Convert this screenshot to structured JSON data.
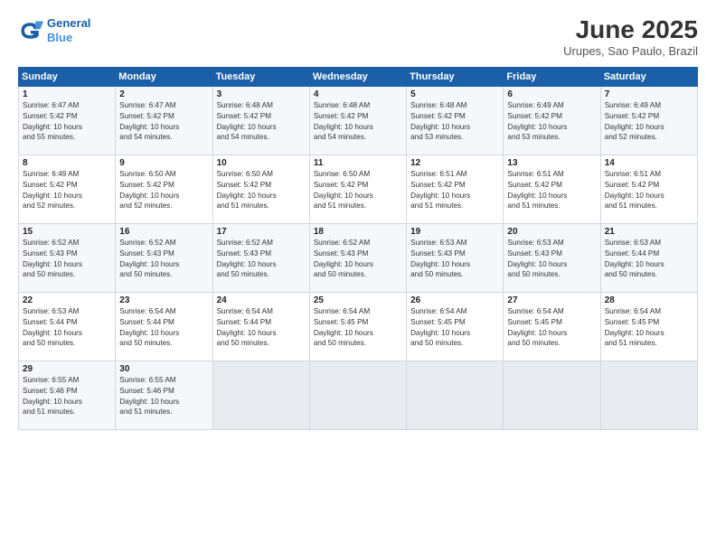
{
  "logo": {
    "line1": "General",
    "line2": "Blue"
  },
  "title": "June 2025",
  "subtitle": "Urupes, Sao Paulo, Brazil",
  "days_of_week": [
    "Sunday",
    "Monday",
    "Tuesday",
    "Wednesday",
    "Thursday",
    "Friday",
    "Saturday"
  ],
  "weeks": [
    [
      {
        "day": "1",
        "info": "Sunrise: 6:47 AM\nSunset: 5:42 PM\nDaylight: 10 hours\nand 55 minutes."
      },
      {
        "day": "2",
        "info": "Sunrise: 6:47 AM\nSunset: 5:42 PM\nDaylight: 10 hours\nand 54 minutes."
      },
      {
        "day": "3",
        "info": "Sunrise: 6:48 AM\nSunset: 5:42 PM\nDaylight: 10 hours\nand 54 minutes."
      },
      {
        "day": "4",
        "info": "Sunrise: 6:48 AM\nSunset: 5:42 PM\nDaylight: 10 hours\nand 54 minutes."
      },
      {
        "day": "5",
        "info": "Sunrise: 6:48 AM\nSunset: 5:42 PM\nDaylight: 10 hours\nand 53 minutes."
      },
      {
        "day": "6",
        "info": "Sunrise: 6:49 AM\nSunset: 5:42 PM\nDaylight: 10 hours\nand 53 minutes."
      },
      {
        "day": "7",
        "info": "Sunrise: 6:49 AM\nSunset: 5:42 PM\nDaylight: 10 hours\nand 52 minutes."
      }
    ],
    [
      {
        "day": "8",
        "info": "Sunrise: 6:49 AM\nSunset: 5:42 PM\nDaylight: 10 hours\nand 52 minutes."
      },
      {
        "day": "9",
        "info": "Sunrise: 6:50 AM\nSunset: 5:42 PM\nDaylight: 10 hours\nand 52 minutes."
      },
      {
        "day": "10",
        "info": "Sunrise: 6:50 AM\nSunset: 5:42 PM\nDaylight: 10 hours\nand 51 minutes."
      },
      {
        "day": "11",
        "info": "Sunrise: 6:50 AM\nSunset: 5:42 PM\nDaylight: 10 hours\nand 51 minutes."
      },
      {
        "day": "12",
        "info": "Sunrise: 6:51 AM\nSunset: 5:42 PM\nDaylight: 10 hours\nand 51 minutes."
      },
      {
        "day": "13",
        "info": "Sunrise: 6:51 AM\nSunset: 5:42 PM\nDaylight: 10 hours\nand 51 minutes."
      },
      {
        "day": "14",
        "info": "Sunrise: 6:51 AM\nSunset: 5:42 PM\nDaylight: 10 hours\nand 51 minutes."
      }
    ],
    [
      {
        "day": "15",
        "info": "Sunrise: 6:52 AM\nSunset: 5:43 PM\nDaylight: 10 hours\nand 50 minutes."
      },
      {
        "day": "16",
        "info": "Sunrise: 6:52 AM\nSunset: 5:43 PM\nDaylight: 10 hours\nand 50 minutes."
      },
      {
        "day": "17",
        "info": "Sunrise: 6:52 AM\nSunset: 5:43 PM\nDaylight: 10 hours\nand 50 minutes."
      },
      {
        "day": "18",
        "info": "Sunrise: 6:52 AM\nSunset: 5:43 PM\nDaylight: 10 hours\nand 50 minutes."
      },
      {
        "day": "19",
        "info": "Sunrise: 6:53 AM\nSunset: 5:43 PM\nDaylight: 10 hours\nand 50 minutes."
      },
      {
        "day": "20",
        "info": "Sunrise: 6:53 AM\nSunset: 5:43 PM\nDaylight: 10 hours\nand 50 minutes."
      },
      {
        "day": "21",
        "info": "Sunrise: 6:53 AM\nSunset: 5:44 PM\nDaylight: 10 hours\nand 50 minutes."
      }
    ],
    [
      {
        "day": "22",
        "info": "Sunrise: 6:53 AM\nSunset: 5:44 PM\nDaylight: 10 hours\nand 50 minutes."
      },
      {
        "day": "23",
        "info": "Sunrise: 6:54 AM\nSunset: 5:44 PM\nDaylight: 10 hours\nand 50 minutes."
      },
      {
        "day": "24",
        "info": "Sunrise: 6:54 AM\nSunset: 5:44 PM\nDaylight: 10 hours\nand 50 minutes."
      },
      {
        "day": "25",
        "info": "Sunrise: 6:54 AM\nSunset: 5:45 PM\nDaylight: 10 hours\nand 50 minutes."
      },
      {
        "day": "26",
        "info": "Sunrise: 6:54 AM\nSunset: 5:45 PM\nDaylight: 10 hours\nand 50 minutes."
      },
      {
        "day": "27",
        "info": "Sunrise: 6:54 AM\nSunset: 5:45 PM\nDaylight: 10 hours\nand 50 minutes."
      },
      {
        "day": "28",
        "info": "Sunrise: 6:54 AM\nSunset: 5:45 PM\nDaylight: 10 hours\nand 51 minutes."
      }
    ],
    [
      {
        "day": "29",
        "info": "Sunrise: 6:55 AM\nSunset: 5:46 PM\nDaylight: 10 hours\nand 51 minutes."
      },
      {
        "day": "30",
        "info": "Sunrise: 6:55 AM\nSunset: 5:46 PM\nDaylight: 10 hours\nand 51 minutes."
      },
      {
        "day": "",
        "info": ""
      },
      {
        "day": "",
        "info": ""
      },
      {
        "day": "",
        "info": ""
      },
      {
        "day": "",
        "info": ""
      },
      {
        "day": "",
        "info": ""
      }
    ]
  ]
}
